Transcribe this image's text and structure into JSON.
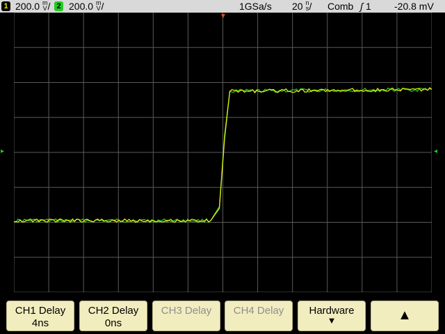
{
  "status": {
    "ch1_num": "1",
    "ch1_scale": "200.0",
    "ch2_num": "2",
    "ch2_scale": "200.0",
    "volts_unit_top": "m",
    "volts_unit_bottom": "V",
    "sample_rate": "1GSa/s",
    "timebase": "20",
    "time_unit_top": "n",
    "time_unit_bottom": "s",
    "acq_mode": "Comb",
    "trigger_source": "1",
    "trigger_level": "-20.8 mV"
  },
  "softkeys": [
    {
      "line1": "CH1 Delay",
      "line2": "4ns",
      "enabled": true
    },
    {
      "line1": "CH2 Delay",
      "line2": "0ns",
      "enabled": true
    },
    {
      "line1": "CH3 Delay",
      "line2": "",
      "enabled": false
    },
    {
      "line1": "CH4 Delay",
      "line2": "",
      "enabled": false
    },
    {
      "line1": "Hardware",
      "line2": "",
      "icon": "down-arrow-icon",
      "enabled": true
    },
    {
      "line1": "",
      "line2": "",
      "icon": "up-arrow-icon",
      "enabled": true
    }
  ],
  "colors": {
    "ch1": "#e8e810",
    "ch2": "#22cc22",
    "grid": "#5a5a5a",
    "trigger": "#e05020",
    "statusbar": "#d9d9d9",
    "softkey": "#f2edbf"
  },
  "chart_data": {
    "type": "line",
    "x_divisions": 12,
    "y_divisions": 8,
    "time_per_div_ns": 20,
    "volts_per_div_mV": 200,
    "series": [
      {
        "name": "1",
        "x_div": [
          0,
          5.65,
          5.9,
          6.05,
          6.2,
          12
        ],
        "y_div": [
          -1.95,
          -1.95,
          -1.6,
          0.4,
          1.75,
          1.8
        ]
      },
      {
        "name": "2",
        "x_div": [
          0,
          5.65,
          5.9,
          6.05,
          6.2,
          12
        ],
        "y_div": [
          -1.95,
          -1.95,
          -1.55,
          0.5,
          1.75,
          1.8
        ]
      }
    ]
  }
}
